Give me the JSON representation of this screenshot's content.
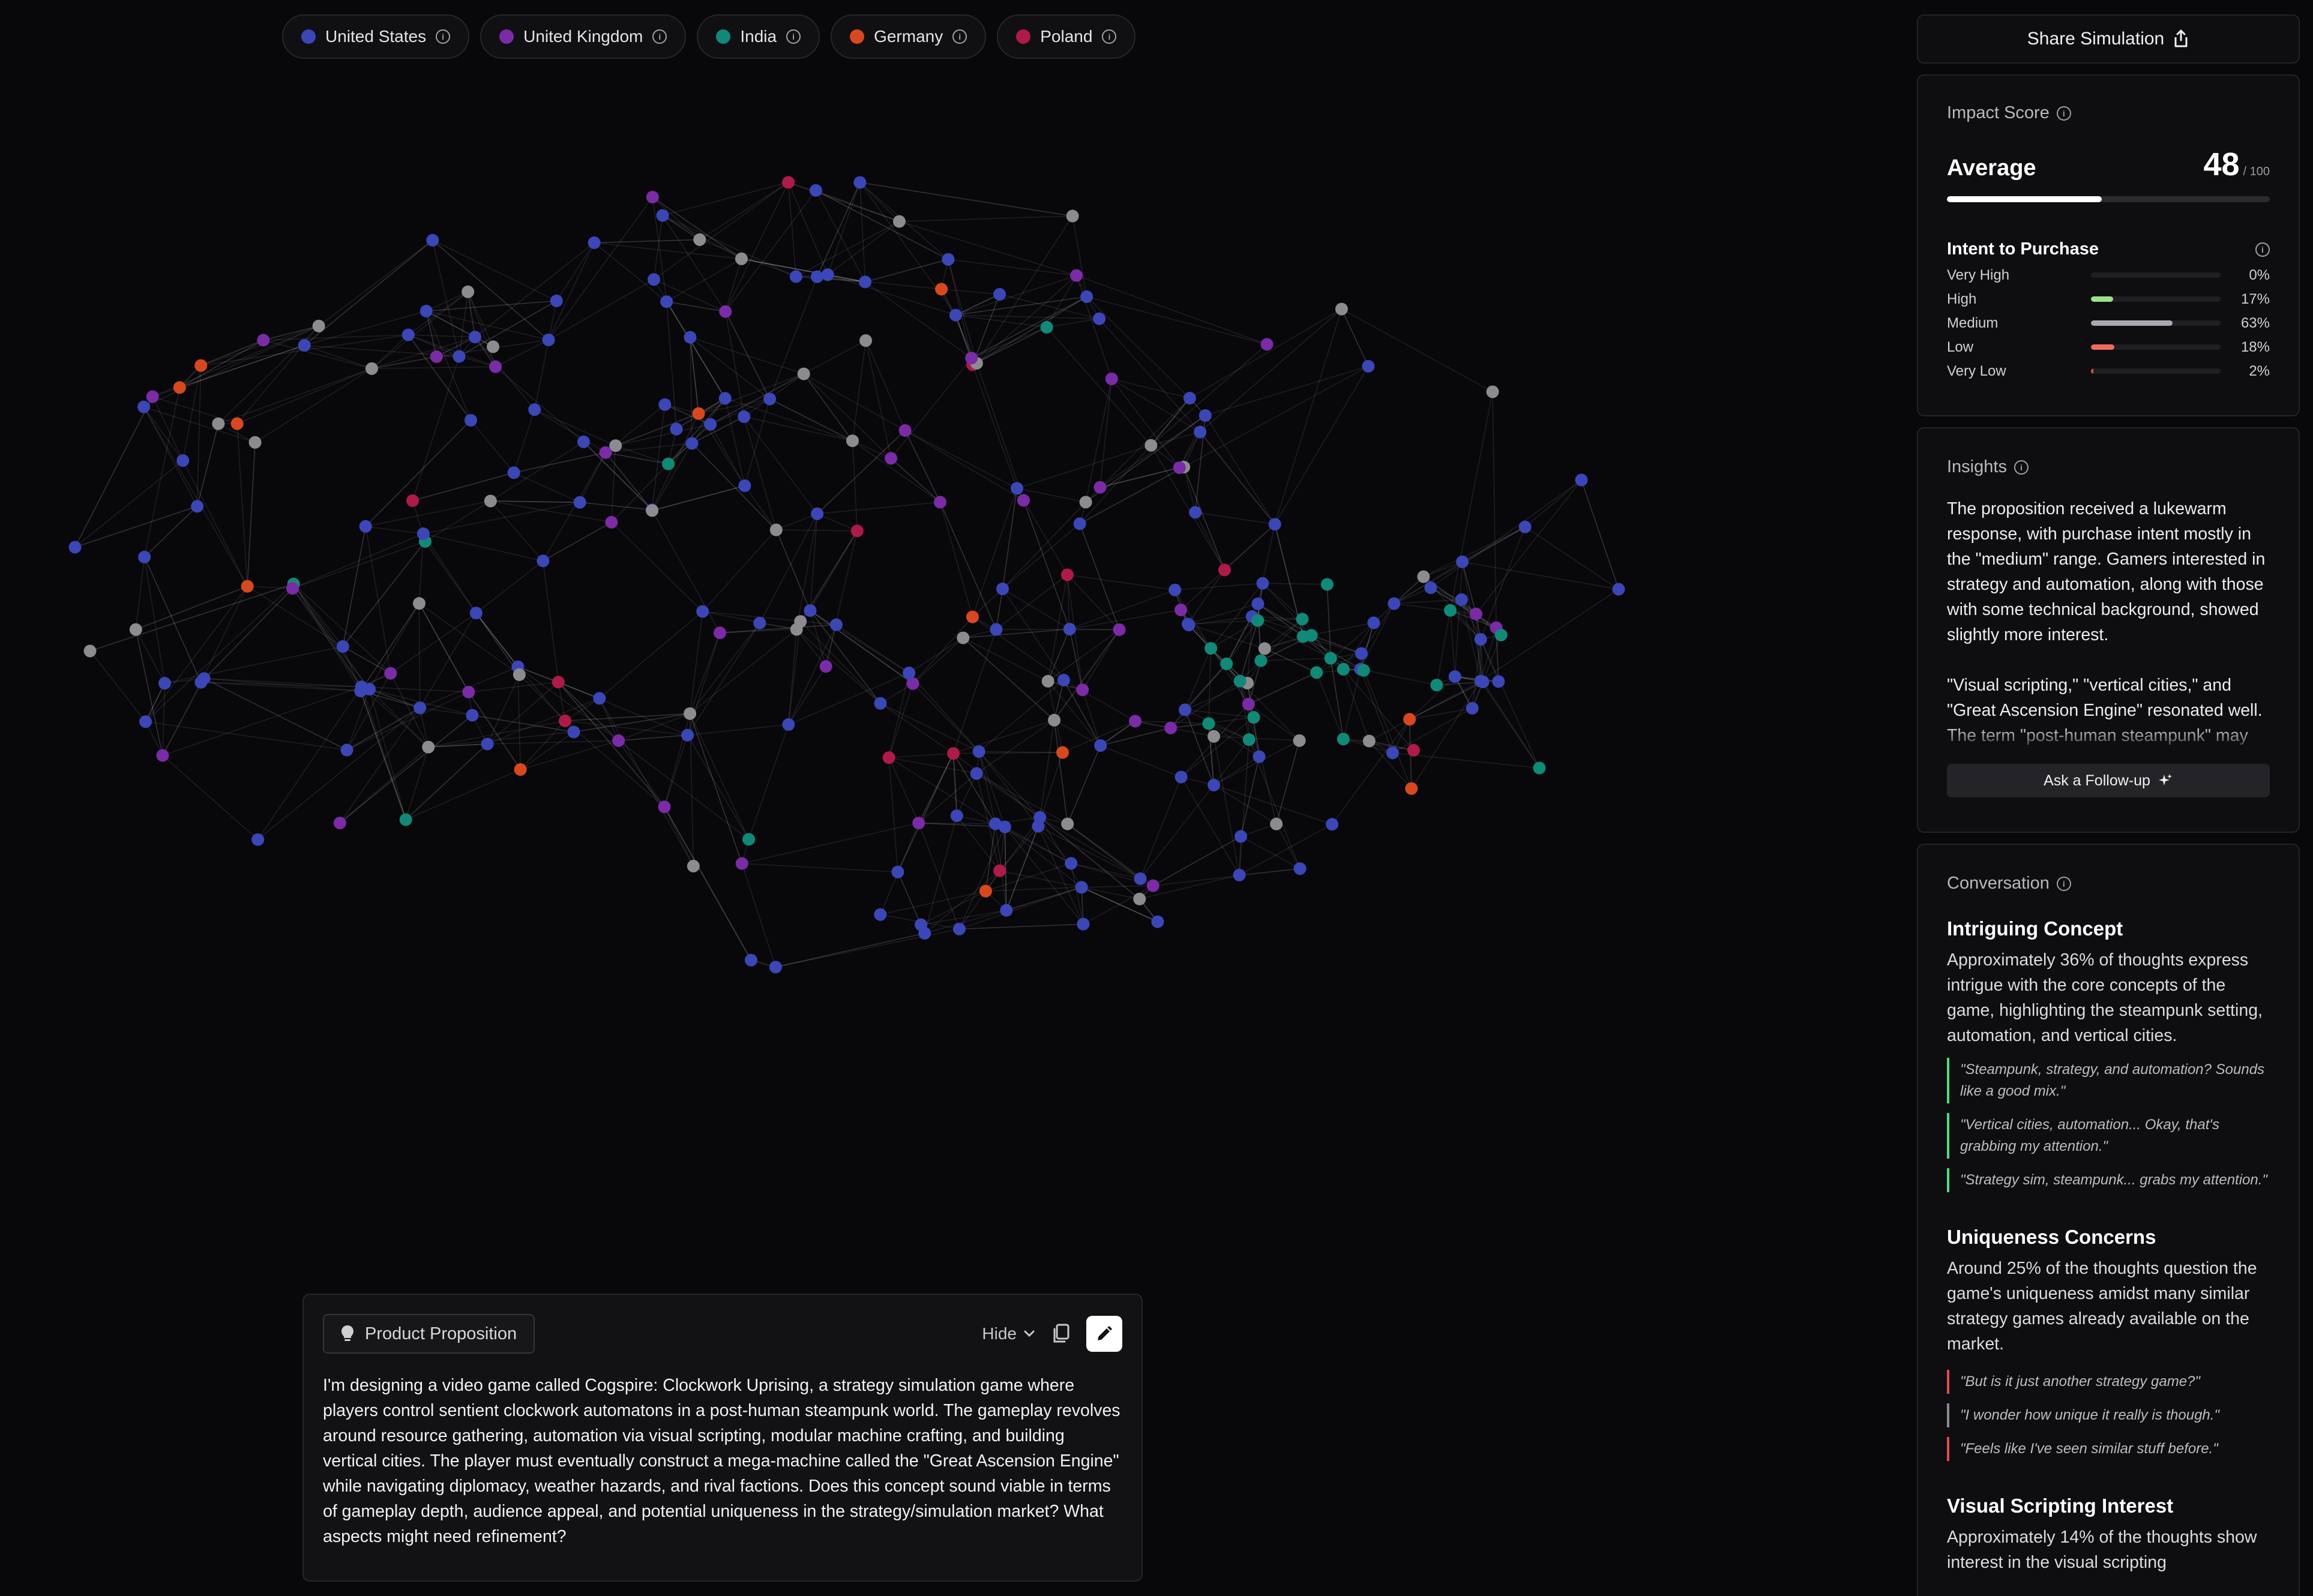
{
  "legend": [
    {
      "label": "United States",
      "color": "#3b46b8"
    },
    {
      "label": "United Kingdom",
      "color": "#7b2aa8"
    },
    {
      "label": "India",
      "color": "#0f8a78"
    },
    {
      "label": "Germany",
      "color": "#d9481c"
    },
    {
      "label": "Poland",
      "color": "#b01a48"
    }
  ],
  "share": {
    "label": "Share Simulation"
  },
  "impact": {
    "title": "Impact Score",
    "rating": "Average",
    "score": "48",
    "score_max": "/ 100",
    "score_value": 48,
    "intent_title": "Intent to Purchase",
    "levels": [
      {
        "label": "Very High",
        "pct": "0%",
        "value": 0,
        "color": "#1f6f3a"
      },
      {
        "label": "High",
        "pct": "17%",
        "value": 17,
        "color": "#9be08a"
      },
      {
        "label": "Medium",
        "pct": "63%",
        "value": 63,
        "color": "#a8a8ae"
      },
      {
        "label": "Low",
        "pct": "18%",
        "value": 18,
        "color": "#f06a5e"
      },
      {
        "label": "Very Low",
        "pct": "2%",
        "value": 2,
        "color": "#e5484d"
      }
    ]
  },
  "insights": {
    "title": "Insights",
    "p1": "The proposition received a lukewarm response, with purchase intent mostly in the \"medium\" range. Gamers interested in strategy and automation, along with those with some technical background, showed slightly more interest.",
    "p2": "\"Visual scripting,\" \"vertical cities,\" and \"Great Ascension Engine\" resonated well. The term \"post-human steampunk\" may be too niche or unclear.",
    "followup": "Ask a Follow-up"
  },
  "conversation": {
    "title": "Conversation",
    "topics": [
      {
        "title": "Intriguing Concept",
        "desc": "Approximately 36% of thoughts express intrigue with the core concepts of the game, highlighting the steampunk setting, automation, and vertical cities.",
        "quotes": [
          "\"Steampunk, strategy, and automation? Sounds like a good mix.\"",
          "\"Vertical cities, automation... Okay, that's grabbing my attention.\"",
          "\"Strategy sim, steampunk... grabs my attention.\""
        ]
      },
      {
        "title": "Uniqueness Concerns",
        "desc": "Around 25% of the thoughts question the game's uniqueness amidst many similar strategy games already available on the market.",
        "quotes": [
          "\"But is it just another strategy game?\"",
          "\"I wonder how unique it really is though.\"",
          "\"Feels like I've seen similar stuff before.\""
        ]
      },
      {
        "title": "Visual Scripting Interest",
        "desc": "Approximately 14% of the thoughts show interest in the visual scripting"
      }
    ]
  },
  "proposition": {
    "tag": "Product Proposition",
    "hide": "Hide",
    "text": "I'm designing a video game called Cogspire: Clockwork Uprising, a strategy simulation game where players control sentient clockwork automatons in a post-human steampunk world. The gameplay revolves around resource gathering, automation via visual scripting, modular machine crafting, and building vertical cities. The player must eventually construct a mega-machine called the \"Great Ascension Engine\" while navigating diplomacy, weather hazards, and rival factions. Does this concept sound viable in terms of gameplay depth, audience appeal, and potential uniqueness in the strategy/simulation market? What aspects might need refinement?"
  }
}
